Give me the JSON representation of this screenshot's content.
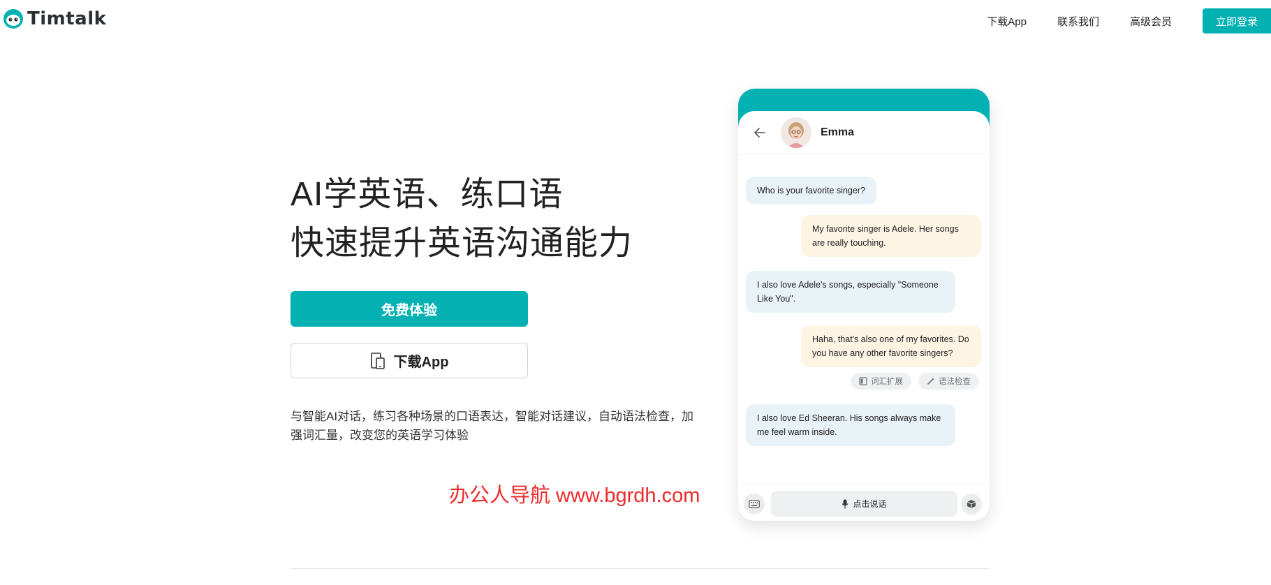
{
  "brand": {
    "name": "Timtalk",
    "accent": "#03b1b3"
  },
  "nav": {
    "download": "下载App",
    "contact": "联系我们",
    "premium": "高级会员",
    "login": "立即登录"
  },
  "hero": {
    "title_line1": "AI学英语、练口语",
    "title_line2": "快速提升英语沟通能力",
    "primary_button": "免费体验",
    "secondary_button": "下载App",
    "description": "与智能AI对话，练习各种场景的口语表达，智能对话建议，自动语法检查，加强词汇量，改变您的英语学习体验"
  },
  "watermark": "办公人导航  www.bgrdh.com",
  "chat": {
    "contact_name": "Emma",
    "messages": [
      {
        "from": "ai",
        "text": "Who is your favorite singer?"
      },
      {
        "from": "user",
        "text": "My favorite singer is Adele. Her songs are really touching."
      },
      {
        "from": "ai",
        "text": "I also love Adele's songs, especially \"Someone Like You\"."
      },
      {
        "from": "user",
        "text": "Haha, that's also one of my favorites. Do you have any other favorite singers?"
      },
      {
        "from": "ai",
        "text": "I also love Ed Sheeran. His songs always make me feel warm inside."
      }
    ],
    "chips": {
      "vocab": "词汇扩展",
      "grammar": "语法检查"
    },
    "talk_label": "点击说话"
  }
}
